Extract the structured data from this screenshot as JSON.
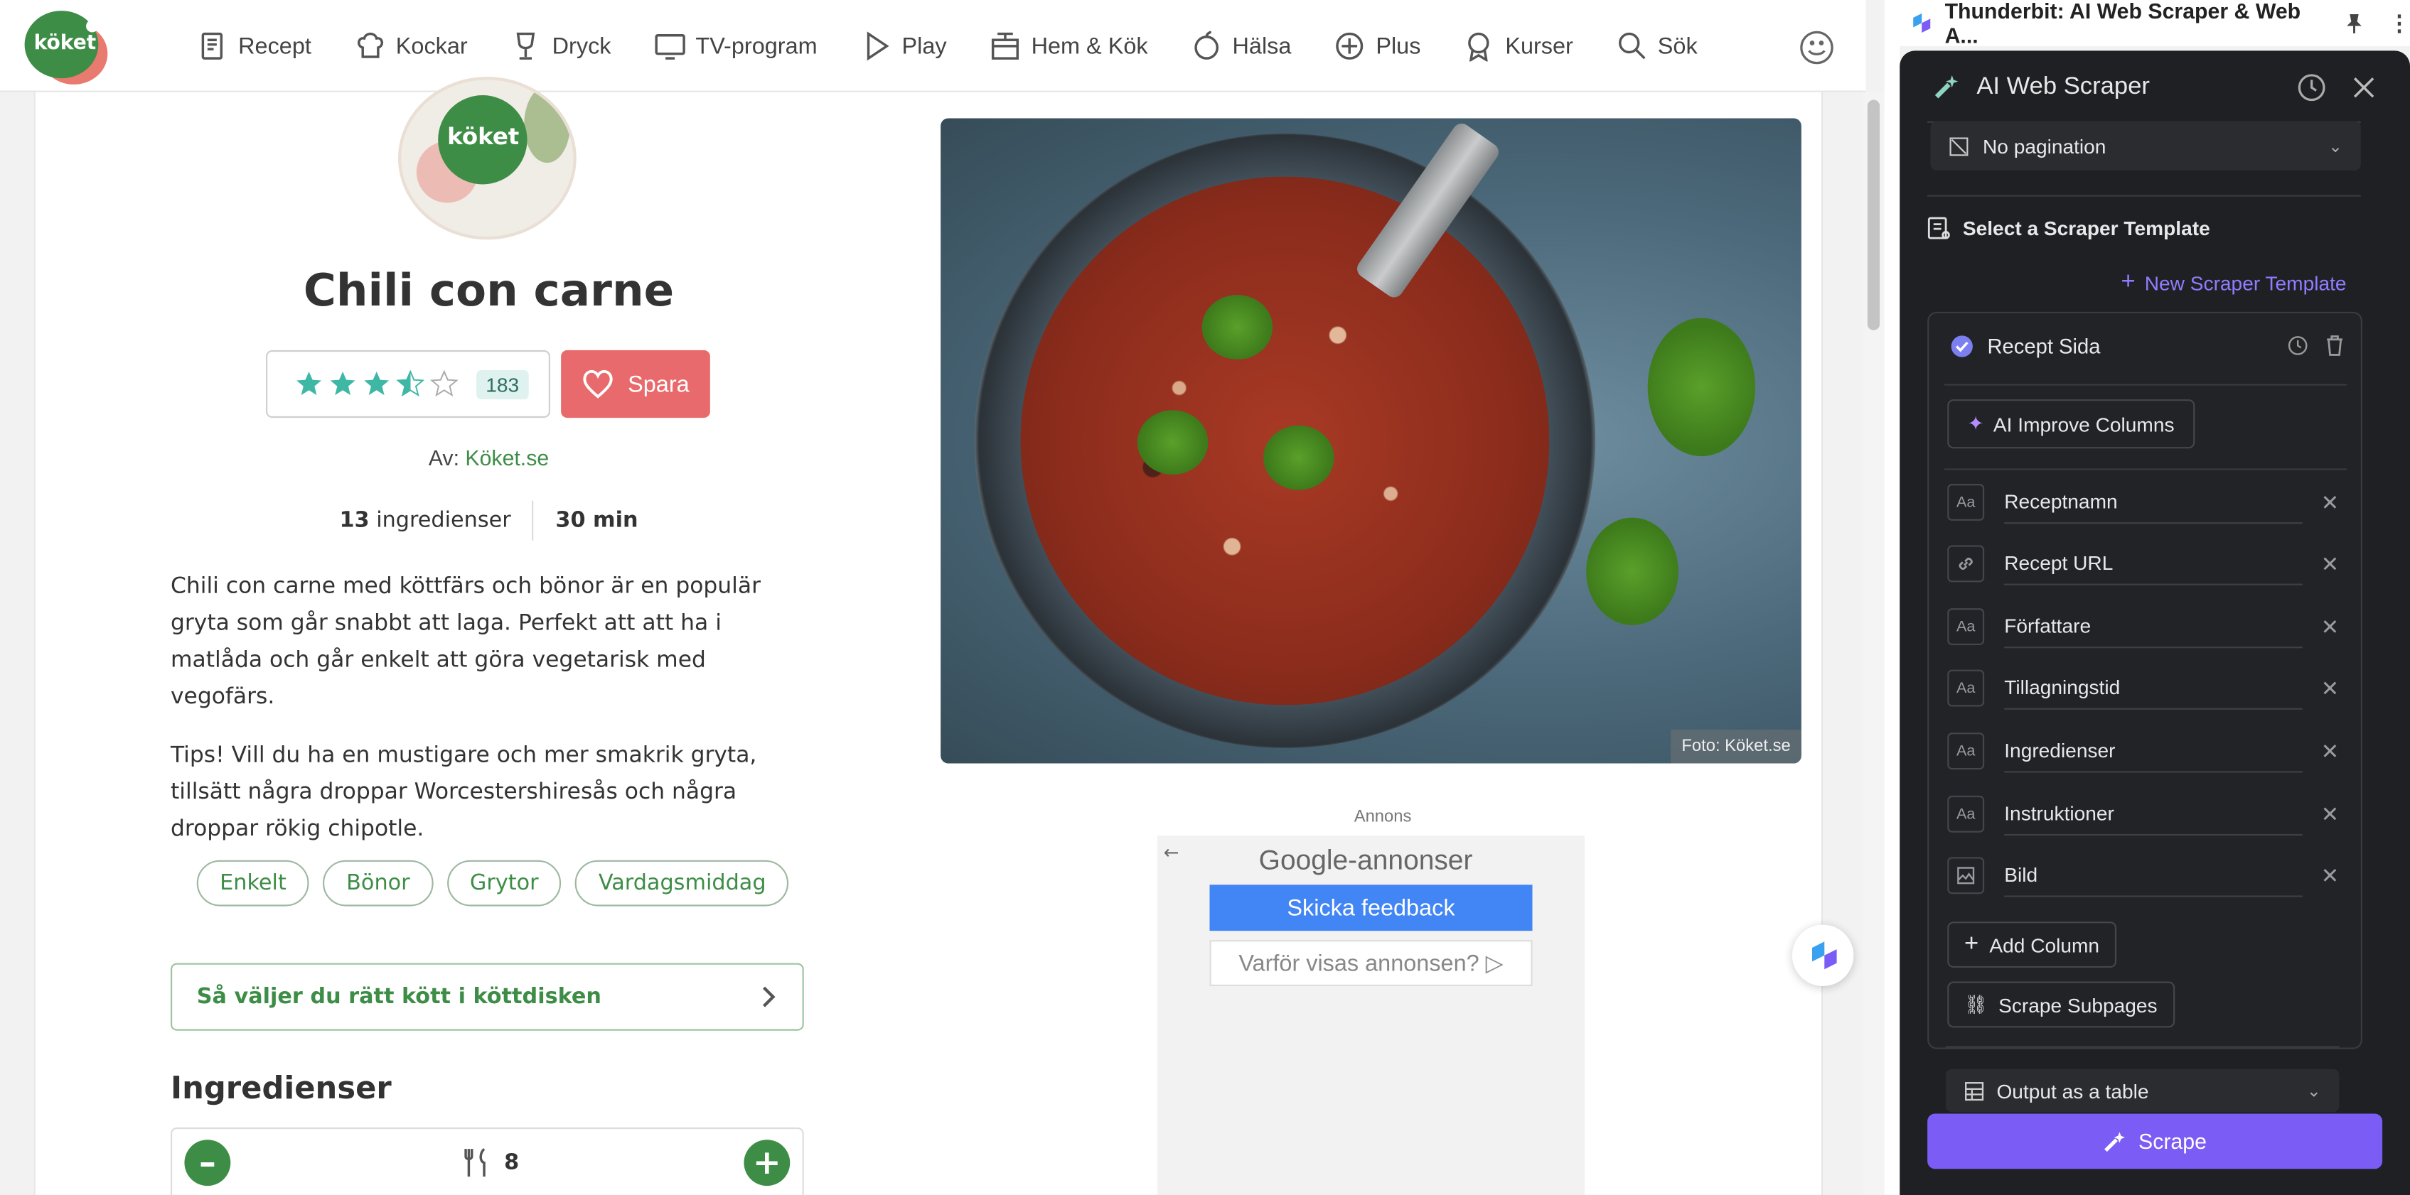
{
  "nav": {
    "logo_text": "köket",
    "items": [
      {
        "label": "Recept",
        "icon": "recipe-book-icon"
      },
      {
        "label": "Kockar",
        "icon": "chef-hat-icon"
      },
      {
        "label": "Dryck",
        "icon": "wine-glass-icon"
      },
      {
        "label": "TV-program",
        "icon": "tv-icon"
      },
      {
        "label": "Play",
        "icon": "play-icon"
      },
      {
        "label": "Hem & Kök",
        "icon": "kitchen-icon"
      },
      {
        "label": "Hälsa",
        "icon": "apple-icon"
      },
      {
        "label": "Plus",
        "icon": "plus-circle-icon"
      },
      {
        "label": "Kurser",
        "icon": "award-icon"
      },
      {
        "label": "Sök",
        "icon": "search-icon"
      }
    ]
  },
  "recipe": {
    "avatar_text": "köket",
    "title": "Chili con carne",
    "rating": 3.5,
    "rating_count": "183",
    "save_label": "Spara",
    "by_prefix": "Av:",
    "author": "Köket.se",
    "ingredients_count": "13",
    "ingredients_label": "ingredienser",
    "time": "30 min",
    "description_1": "Chili con carne med köttfärs och bönor är en populär gryta som går snabbt att laga. Perfekt att att ha i matlåda och går enkelt att göra vegetarisk med vegofärs.",
    "description_2": "Tips! Vill du ha en mustigare och mer smakrik gryta, tillsätt några droppar Worcestershiresås och några droppar rökig chipotle.",
    "tags": [
      "Enkelt",
      "Bönor",
      "Grytor",
      "Vardagsmiddag"
    ],
    "link_text": "Så väljer du rätt kött i köttdisken",
    "ingredients_heading": "Ingredienser",
    "servings": "8",
    "photo_credit": "Foto: Köket.se"
  },
  "ad": {
    "label": "Annons",
    "google": "Google",
    "google_suffix": "-annonser",
    "feedback": "Skicka feedback",
    "why": "Varför visas annonsen?"
  },
  "extension": {
    "header_title": "Thunderbit: AI Web Scraper & Web A...",
    "panel_title": "AI Web Scraper",
    "pagination": "No pagination",
    "select_template": "Select a Scraper Template",
    "new_template": "New Scraper Template",
    "template_name": "Recept Sida",
    "ai_improve": "AI Improve Columns",
    "columns": [
      {
        "name": "Receptnamn",
        "icon": "text-type-icon",
        "glyph": "Aa"
      },
      {
        "name": "Recept URL",
        "icon": "link-icon",
        "glyph": "🔗"
      },
      {
        "name": "Författare",
        "icon": "text-type-icon",
        "glyph": "Aa"
      },
      {
        "name": "Tillagningstid",
        "icon": "text-type-icon",
        "glyph": "Aa"
      },
      {
        "name": "Ingredienser",
        "icon": "text-type-icon",
        "glyph": "Aa"
      },
      {
        "name": "Instruktioner",
        "icon": "text-type-icon",
        "glyph": "Aa"
      },
      {
        "name": "Bild",
        "icon": "image-icon",
        "glyph": "▣"
      }
    ],
    "add_column": "Add Column",
    "scrape_subpages": "Scrape Subpages",
    "output": "Output as a table",
    "scrape": "Scrape"
  },
  "colors": {
    "brand_green": "#3e8d47",
    "save_red": "#e96a6c",
    "accent_purple": "#7b5cf5",
    "panel_bg": "#1f2023"
  }
}
